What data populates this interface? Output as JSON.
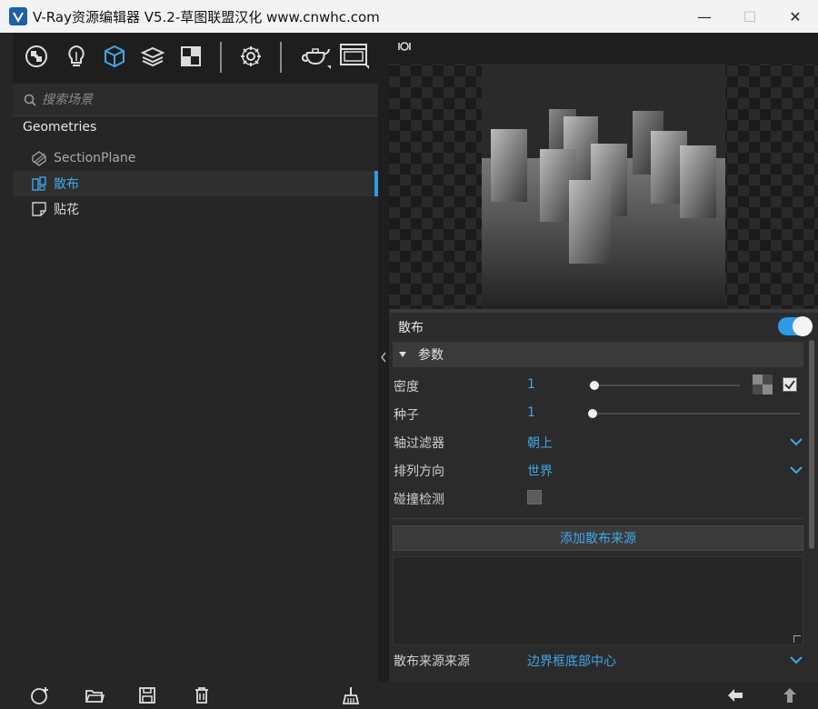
{
  "window": {
    "title": "V-Ray资源编辑器 V5.2-草图联盟汉化 www.cnwhc.com",
    "minimize": "—",
    "maximize": "☐",
    "close": "✕"
  },
  "toolbar": {
    "icons": [
      "materials-icon",
      "lights-icon",
      "geometry-icon",
      "layers-icon",
      "textures-icon",
      "settings-icon",
      "teapot-render-icon",
      "render-window-icon"
    ],
    "active": "geometry-icon"
  },
  "search": {
    "placeholder": "搜索场景"
  },
  "tree": {
    "header": "Geometries",
    "items": [
      {
        "label": "SectionPlane",
        "icon": "section-plane-icon",
        "selected": false
      },
      {
        "label": "散布",
        "icon": "scatter-icon",
        "selected": true
      },
      {
        "label": "贴花",
        "icon": "decal-icon",
        "selected": false
      }
    ]
  },
  "node": {
    "title": "散布",
    "enabled": true,
    "section": "参数",
    "props": [
      {
        "label": "密度",
        "value": "1",
        "type": "slider",
        "level": 0.02
      },
      {
        "label": "种子",
        "value": "1",
        "type": "slider",
        "level": 0.0
      },
      {
        "label": "轴过滤器",
        "value": "朝上",
        "type": "dropdown"
      },
      {
        "label": "排列方向",
        "value": "世界",
        "type": "dropdown"
      },
      {
        "label": "碰撞检测",
        "value": "",
        "type": "checkbox",
        "checked": false
      }
    ],
    "add_source": "添加散布来源",
    "source_origin": {
      "label": "散布来源来源",
      "value": "边界框底部中心"
    }
  },
  "colors": {
    "accent": "#2f9be6",
    "panel": "#2b2b2b",
    "text_blue": "#3fa7e8"
  }
}
